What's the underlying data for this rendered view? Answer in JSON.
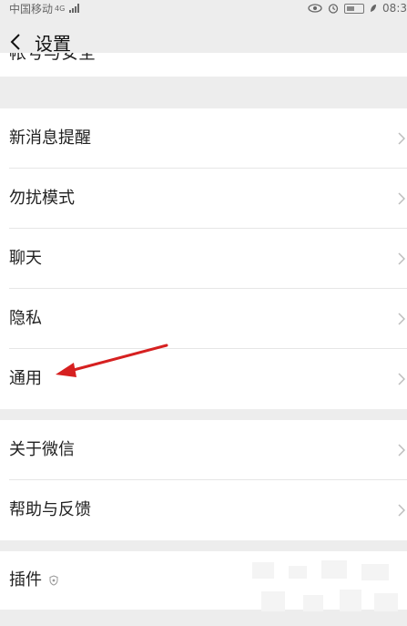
{
  "status_bar": {
    "carrier": "中国移动",
    "network": "4G",
    "time": "08:3"
  },
  "header": {
    "title": "设置",
    "back_icon": "chevron-left-icon"
  },
  "partial_row": {
    "label": "帐号与安全"
  },
  "groups": [
    {
      "items": [
        {
          "label": "新消息提醒"
        },
        {
          "label": "勿扰模式"
        },
        {
          "label": "聊天"
        },
        {
          "label": "隐私"
        },
        {
          "label": "通用"
        }
      ]
    },
    {
      "items": [
        {
          "label": "关于微信"
        },
        {
          "label": "帮助与反馈"
        }
      ]
    },
    {
      "items": [
        {
          "label": "插件"
        }
      ]
    }
  ],
  "colors": {
    "background": "#ededed",
    "row_background": "#ffffff",
    "annotation_arrow": "#d62020"
  }
}
